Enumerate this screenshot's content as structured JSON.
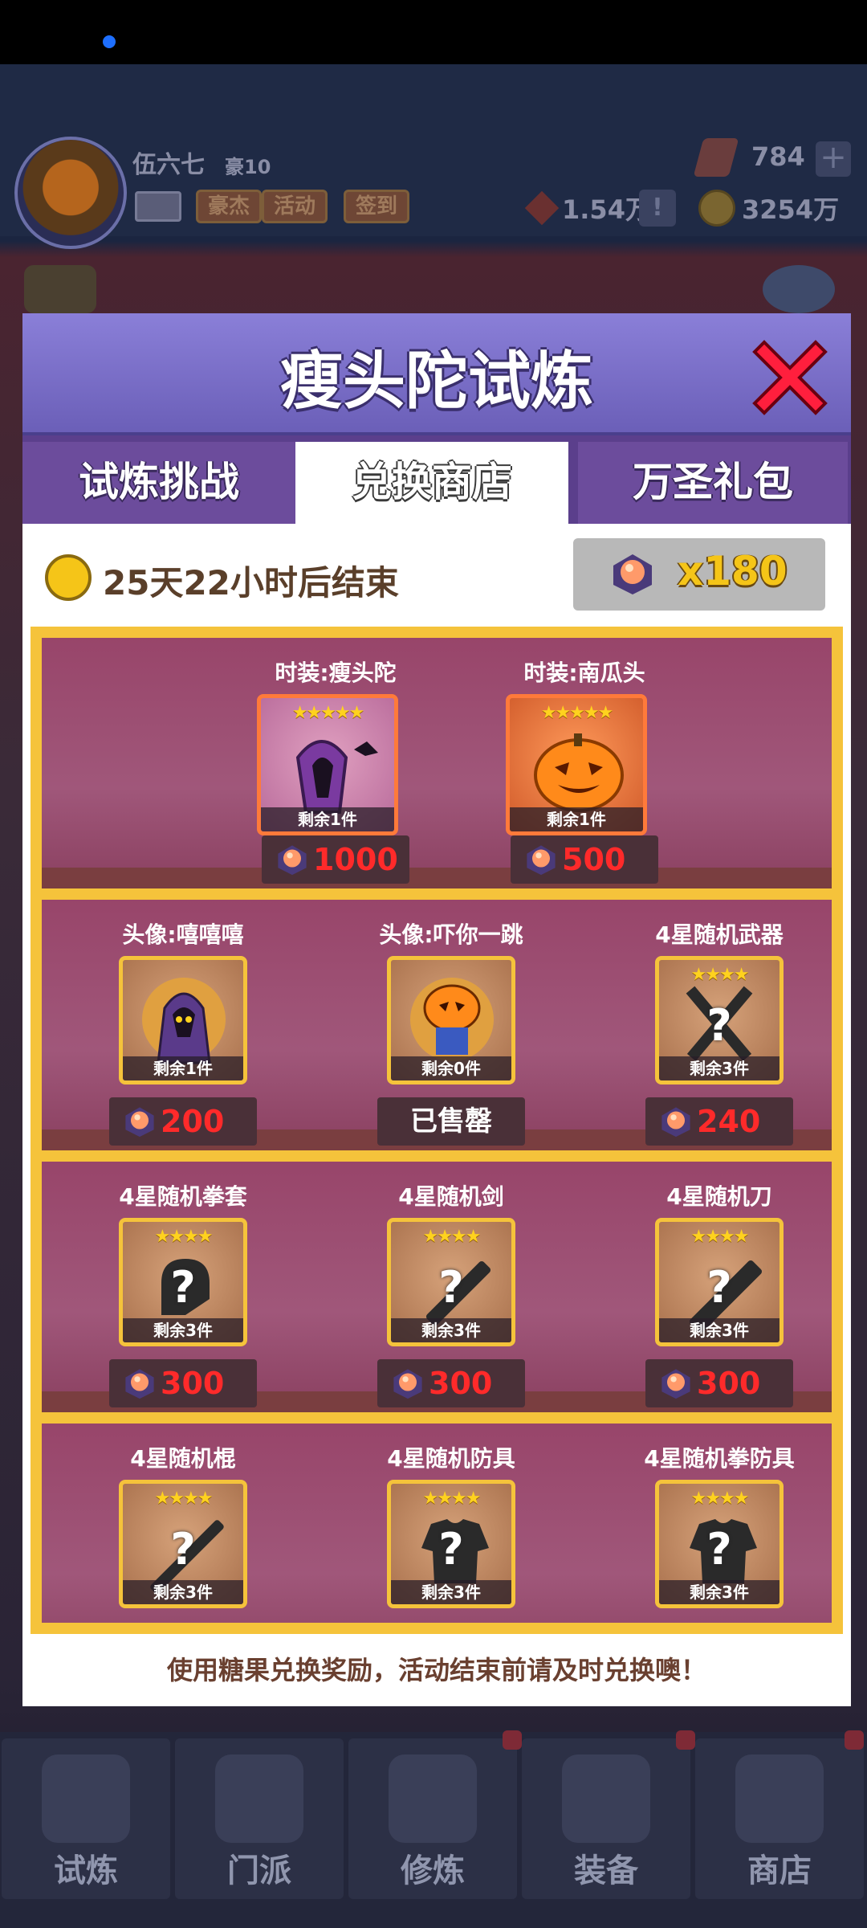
{
  "background": {
    "player_name": "伍六七",
    "player_rank": "豪10",
    "tags": [
      "豪杰",
      "活动",
      "签到"
    ],
    "gems": "784",
    "red_currency": "1.54万",
    "coins": "3254万",
    "plus_label": "+",
    "excl_label": "!",
    "nav": [
      "试炼",
      "门派",
      "修炼",
      "装备",
      "商店"
    ]
  },
  "modal": {
    "title": "瘦头陀试炼",
    "tabs": [
      "试炼挑战",
      "兑换商店",
      "万圣礼包"
    ],
    "active_tab": "兑换商店",
    "timer_text": "25天22小时后结束",
    "candy_count": "x180",
    "footer": "使用糖果兑换奖励，活动结束前请及时兑换噢！"
  },
  "shop": {
    "rows": [
      [
        {
          "name": "时装:瘦头陀",
          "stars": "★★★★★",
          "remain": "剩余1件",
          "price": "1000",
          "icon": "hooded-figure-icon"
        },
        {
          "name": "时装:南瓜头",
          "stars": "★★★★★",
          "remain": "剩余1件",
          "price": "500",
          "icon": "pumpkin-icon"
        }
      ],
      [
        {
          "name": "头像:嘻嘻嘻",
          "stars": "",
          "remain": "剩余1件",
          "price": "200",
          "icon": "hooded-avatar-icon"
        },
        {
          "name": "头像:吓你一跳",
          "stars": "",
          "remain": "剩余0件",
          "price": "已售罄",
          "icon": "pumpkin-avatar-icon"
        },
        {
          "name": "4星随机武器",
          "stars": "★★★★",
          "remain": "剩余3件",
          "price": "240",
          "icon": "crossed-swords-icon"
        }
      ],
      [
        {
          "name": "4星随机拳套",
          "stars": "★★★★",
          "remain": "剩余3件",
          "price": "300",
          "icon": "gauntlet-icon"
        },
        {
          "name": "4星随机剑",
          "stars": "★★★★",
          "remain": "剩余3件",
          "price": "300",
          "icon": "sword-icon"
        },
        {
          "name": "4星随机刀",
          "stars": "★★★★",
          "remain": "剩余3件",
          "price": "300",
          "icon": "blade-icon"
        }
      ],
      [
        {
          "name": "4星随机棍",
          "stars": "★★★★",
          "remain": "剩余3件",
          "icon": "staff-icon"
        },
        {
          "name": "4星随机防具",
          "stars": "★★★★",
          "remain": "剩余3件",
          "icon": "armor-icon"
        },
        {
          "name": "4星随机拳防具",
          "stars": "★★★★",
          "remain": "剩余3件",
          "icon": "fist-armor-icon"
        }
      ]
    ],
    "question_mark": "?"
  },
  "colors": {
    "accent_gold": "#f5c33b",
    "price_red": "#ff2a2a",
    "header_purple": "#6b5fb8",
    "shop_bg": "#a0516e"
  }
}
